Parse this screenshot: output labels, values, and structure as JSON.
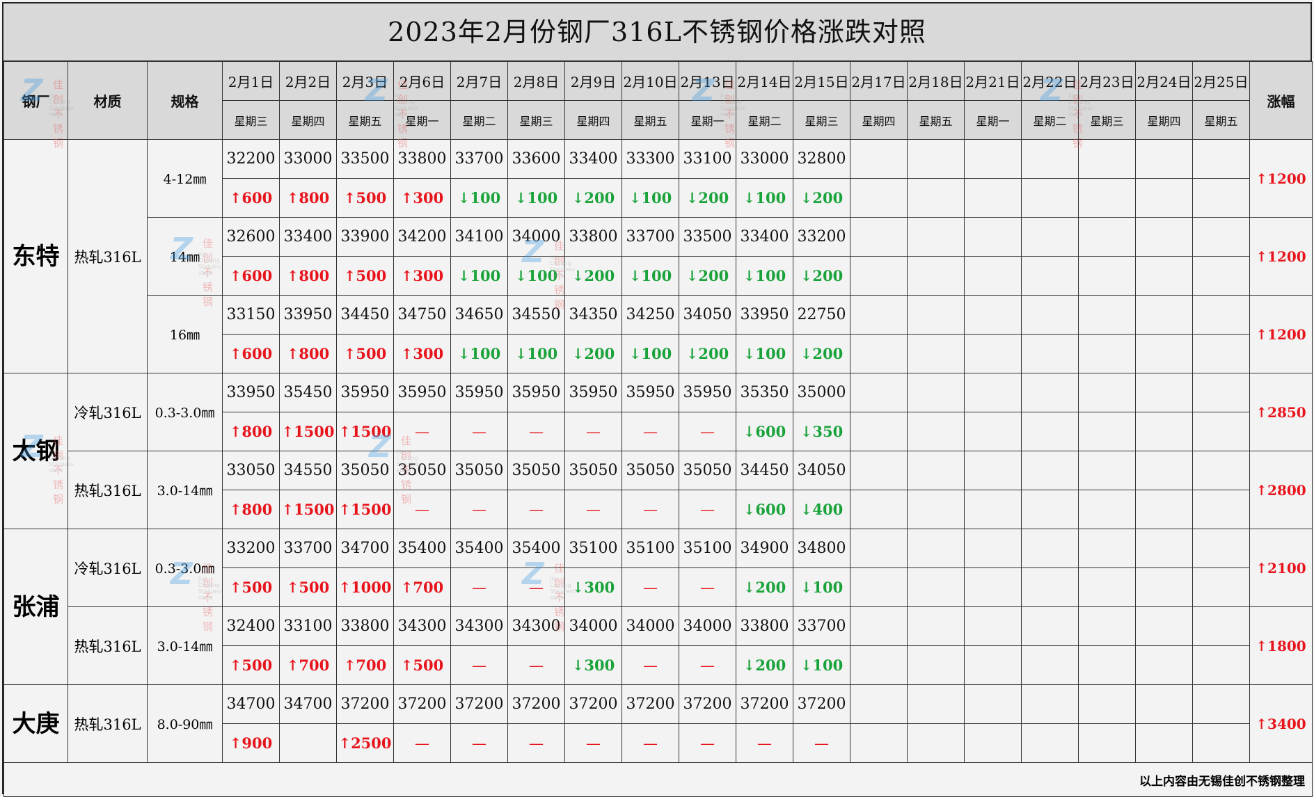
{
  "title": "2023年2月份钢厂316L不锈钢价格涨跌对照",
  "header": {
    "mill": "钢厂",
    "material": "材质",
    "spec": "规格",
    "total": "涨幅",
    "dates": [
      "2月1日",
      "2月2日",
      "2月3日",
      "2月6日",
      "2月7日",
      "2月8日",
      "2月9日",
      "2月10日",
      "2月13日",
      "2月14日",
      "2月15日",
      "2月17日",
      "2月18日",
      "2月21日",
      "2月22日",
      "2月23日",
      "2月24日",
      "2月25日"
    ],
    "weekdays": [
      "星期三",
      "星期四",
      "星期五",
      "星期一",
      "星期二",
      "星期三",
      "星期四",
      "星期五",
      "星期一",
      "星期二",
      "星期三",
      "星期四",
      "星期五",
      "星期一",
      "星期二",
      "星期三",
      "星期四",
      "星期五"
    ]
  },
  "mills": [
    {
      "name": "东特",
      "groups": [
        {
          "material": "热轧316L",
          "specs": [
            {
              "spec": "4-12㎜",
              "prices": [
                "32200",
                "33000",
                "33500",
                "33800",
                "33700",
                "33600",
                "33400",
                "33300",
                "33100",
                "33000",
                "32800"
              ],
              "changes": [
                "↑600",
                "↑800",
                "↑500",
                "↑300",
                "↓100",
                "↓100",
                "↓200",
                "↓100",
                "↓200",
                "↓100",
                "↓200"
              ],
              "total": "↑1200"
            },
            {
              "spec": "14㎜",
              "prices": [
                "32600",
                "33400",
                "33900",
                "34200",
                "34100",
                "34000",
                "33800",
                "33700",
                "33500",
                "33400",
                "33200"
              ],
              "changes": [
                "↑600",
                "↑800",
                "↑500",
                "↑300",
                "↓100",
                "↓100",
                "↓200",
                "↓100",
                "↓200",
                "↓100",
                "↓200"
              ],
              "total": "↑1200"
            },
            {
              "spec": "16㎜",
              "prices": [
                "33150",
                "33950",
                "34450",
                "34750",
                "34650",
                "34550",
                "34350",
                "34250",
                "34050",
                "33950",
                "22750"
              ],
              "changes": [
                "↑600",
                "↑800",
                "↑500",
                "↑300",
                "↓100",
                "↓100",
                "↓200",
                "↓100",
                "↓200",
                "↓100",
                "↓200"
              ],
              "total": "↑1200"
            }
          ]
        }
      ]
    },
    {
      "name": "太钢",
      "groups": [
        {
          "material": "冷轧316L",
          "specs": [
            {
              "spec": "0.3-3.0㎜",
              "prices": [
                "33950",
                "35450",
                "35950",
                "35950",
                "35950",
                "35950",
                "35950",
                "35950",
                "35950",
                "35350",
                "35000"
              ],
              "changes": [
                "↑800",
                "↑1500",
                "↑1500",
                "—",
                "—",
                "—",
                "—",
                "—",
                "—",
                "↓600",
                "↓350"
              ],
              "total": "↑2850"
            }
          ]
        },
        {
          "material": "热轧316L",
          "specs": [
            {
              "spec": "3.0-14㎜",
              "prices": [
                "33050",
                "34550",
                "35050",
                "35050",
                "35050",
                "35050",
                "35050",
                "35050",
                "35050",
                "34450",
                "34050"
              ],
              "changes": [
                "↑800",
                "↑1500",
                "↑1500",
                "—",
                "—",
                "—",
                "—",
                "—",
                "—",
                "↓600",
                "↓400"
              ],
              "total": "↑2800"
            }
          ]
        }
      ]
    },
    {
      "name": "张浦",
      "groups": [
        {
          "material": "冷轧316L",
          "specs": [
            {
              "spec": "0.3-3.0㎜",
              "prices": [
                "33200",
                "33700",
                "34700",
                "35400",
                "35400",
                "35400",
                "35100",
                "35100",
                "35100",
                "34900",
                "34800"
              ],
              "changes": [
                "↑500",
                "↑500",
                "↑1000",
                "↑700",
                "—",
                "—",
                "↓300",
                "—",
                "—",
                "↓200",
                "↓100"
              ],
              "total": "↑2100"
            }
          ]
        },
        {
          "material": "热轧316L",
          "specs": [
            {
              "spec": "3.0-14㎜",
              "prices": [
                "32400",
                "33100",
                "33800",
                "34300",
                "34300",
                "34300",
                "34000",
                "34000",
                "34000",
                "33800",
                "33700"
              ],
              "changes": [
                "↑500",
                "↑700",
                "↑700",
                "↑500",
                "—",
                "—",
                "↓300",
                "—",
                "—",
                "↓200",
                "↓100"
              ],
              "total": "↑1800"
            }
          ]
        }
      ]
    },
    {
      "name": "大庚",
      "groups": [
        {
          "material": "热轧316L",
          "specs": [
            {
              "spec": "8.0-90㎜",
              "prices": [
                "34700",
                "34700",
                "37200",
                "37200",
                "37200",
                "37200",
                "37200",
                "37200",
                "37200",
                "37200",
                "37200"
              ],
              "changes": [
                "↑900",
                "",
                "↑2500",
                "—",
                "—",
                "—",
                "—",
                "—",
                "—",
                "—",
                "—"
              ],
              "total": "↑3400"
            }
          ]
        }
      ]
    }
  ],
  "footer": "以上内容由无锡佳创不锈钢整理",
  "watermark": {
    "text": "佳创不锈钢",
    "sub": "Jia Chuang Stainless steel",
    "logo": "Z"
  },
  "colors": {
    "up": "#e8141c",
    "down": "#1aa33a",
    "header_bg": "#d9d9d9",
    "body_bg": "#f3f3f3"
  }
}
